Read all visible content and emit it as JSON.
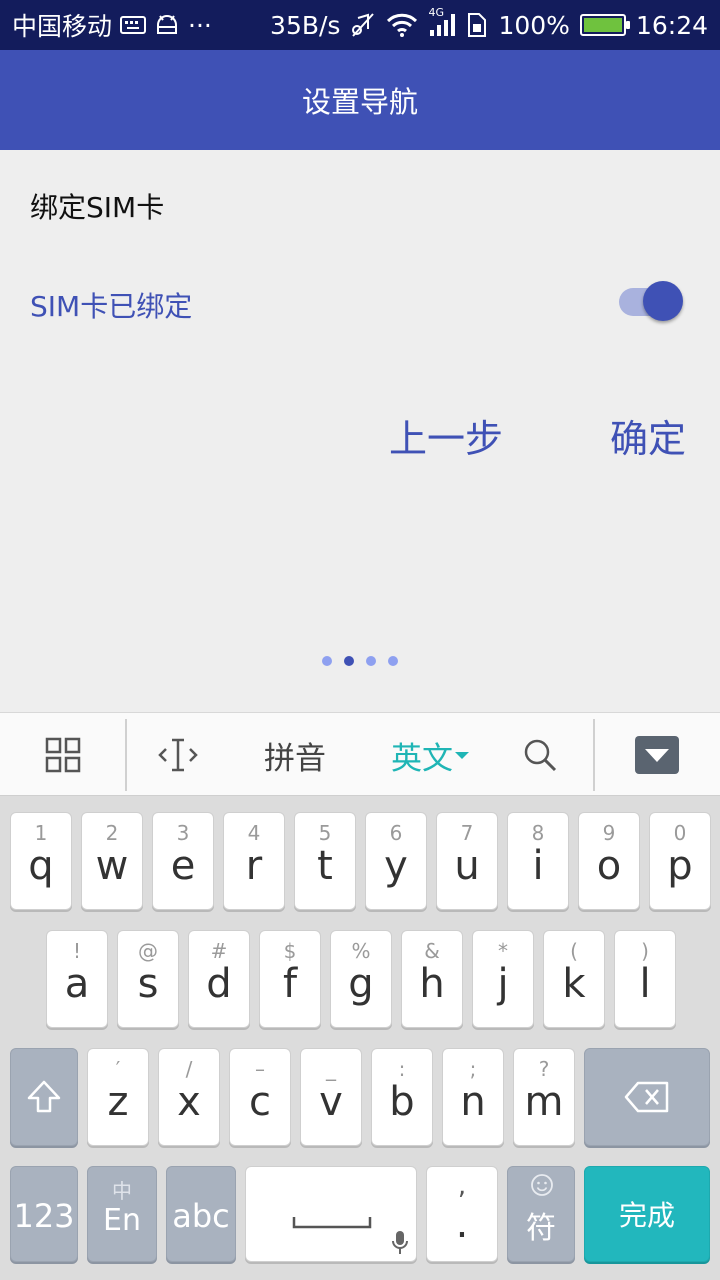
{
  "status_bar": {
    "carrier": "中国移动",
    "net_speed": "35B/s",
    "network_type": "4G",
    "battery": "100%",
    "time": "16:24",
    "more": "···"
  },
  "app_bar": {
    "title": "设置导航"
  },
  "main": {
    "section_title": "绑定SIM卡",
    "sim_status": "SIM卡已绑定",
    "toggle_on": true,
    "prev_button": "上一步",
    "confirm_button": "确定",
    "page_count": 4,
    "current_page": 2
  },
  "ime_toolbar": {
    "pinyin": "拼音",
    "english": "英文"
  },
  "keyboard": {
    "row1": [
      {
        "sub": "1",
        "key": "q"
      },
      {
        "sub": "2",
        "key": "w"
      },
      {
        "sub": "3",
        "key": "e"
      },
      {
        "sub": "4",
        "key": "r"
      },
      {
        "sub": "5",
        "key": "t"
      },
      {
        "sub": "6",
        "key": "y"
      },
      {
        "sub": "7",
        "key": "u"
      },
      {
        "sub": "8",
        "key": "i"
      },
      {
        "sub": "9",
        "key": "o"
      },
      {
        "sub": "0",
        "key": "p"
      }
    ],
    "row2": [
      {
        "sub": "!",
        "key": "a"
      },
      {
        "sub": "@",
        "key": "s"
      },
      {
        "sub": "#",
        "key": "d"
      },
      {
        "sub": "$",
        "key": "f"
      },
      {
        "sub": "%",
        "key": "g"
      },
      {
        "sub": "&",
        "key": "h"
      },
      {
        "sub": "*",
        "key": "j"
      },
      {
        "sub": "(",
        "key": "k"
      },
      {
        "sub": ")",
        "key": "l"
      }
    ],
    "row3": [
      {
        "sub": "′",
        "key": "z"
      },
      {
        "sub": "/",
        "key": "x"
      },
      {
        "sub": "–",
        "key": "c"
      },
      {
        "sub": "_",
        "key": "v"
      },
      {
        "sub": ":",
        "key": "b"
      },
      {
        "sub": ";",
        "key": "n"
      },
      {
        "sub": "?",
        "key": "m"
      }
    ],
    "num_key": "123",
    "lang_key_sub": "中",
    "lang_key": "En",
    "abc_key": "abc",
    "comma_key": ",",
    "period_key": ".",
    "symbol_key": "符",
    "done_key": "完成"
  },
  "colors": {
    "primary": "#3f51b5",
    "status_bar": "#131c5c",
    "accent_teal": "#22b7bd"
  }
}
